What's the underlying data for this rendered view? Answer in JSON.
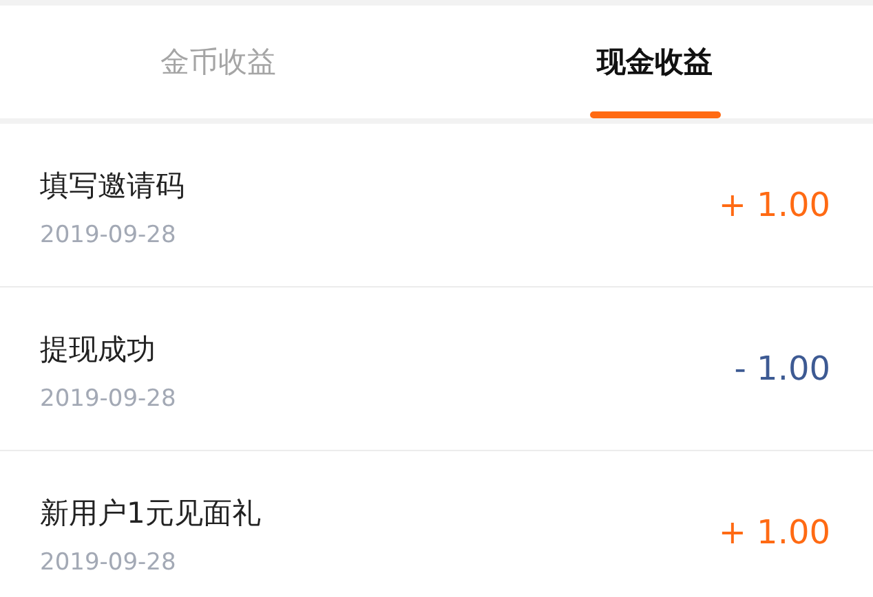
{
  "tabs": [
    {
      "label": "金币收益",
      "selected": false
    },
    {
      "label": "现金收益",
      "selected": true
    }
  ],
  "records": [
    {
      "title": "填写邀请码",
      "date": "2019-09-28",
      "amount": "+ 1.00",
      "kind": "income"
    },
    {
      "title": "提现成功",
      "date": "2019-09-28",
      "amount": "- 1.00",
      "kind": "expense"
    },
    {
      "title": "新用户1元见面礼",
      "date": "2019-09-28",
      "amount": "+ 1.00",
      "kind": "income"
    }
  ]
}
